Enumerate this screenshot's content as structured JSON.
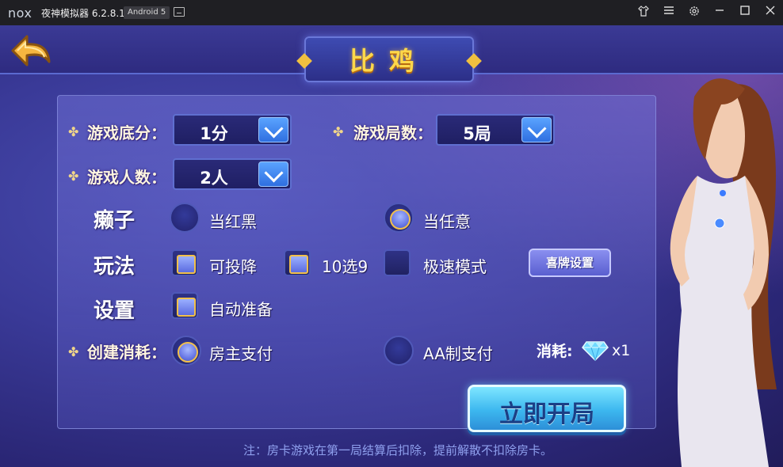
{
  "titlebar": {
    "logo": "nox",
    "app_title": "夜神模拟器 6.2.8.1",
    "android_badge": "Android 5",
    "icons": [
      "screen-icon",
      "shirt-icon",
      "menu-icon",
      "gear-icon",
      "minimize-icon",
      "maximize-icon",
      "close-icon"
    ]
  },
  "header": {
    "title": "比鸡",
    "back_icon": "back-arrow-icon"
  },
  "settings": {
    "base_score": {
      "label": "游戏底分：",
      "value": "1分"
    },
    "rounds": {
      "label": "游戏局数：",
      "value": "5局"
    },
    "players": {
      "label": "游戏人数：",
      "value": "2人"
    },
    "laizi": {
      "label": "癞子",
      "options": [
        {
          "text": "当红黑",
          "selected": false
        },
        {
          "text": "当任意",
          "selected": true
        }
      ]
    },
    "play": {
      "label": "玩法",
      "options": [
        {
          "text": "可投降",
          "checked": true
        },
        {
          "text": "10选9",
          "checked": true
        },
        {
          "text": "极速模式",
          "checked": false
        }
      ],
      "xipai_button": "喜牌设置"
    },
    "setup": {
      "label": "设置",
      "options": [
        {
          "text": "自动准备",
          "checked": true
        }
      ]
    },
    "cost": {
      "label": "创建消耗：",
      "options": [
        {
          "text": "房主支付",
          "selected": true
        },
        {
          "text": "AA制支付",
          "selected": false
        }
      ],
      "consume_label": "消耗:",
      "consume_count": "x1"
    }
  },
  "start_button": "立即开局",
  "note": "注：房卡游戏在第一局结算后扣除，提前解散不扣除房卡。",
  "colors": {
    "accent_gold": "#ffd84a",
    "panel_blue": "#3a3a98",
    "button_cyan": "#3cb7ef"
  }
}
